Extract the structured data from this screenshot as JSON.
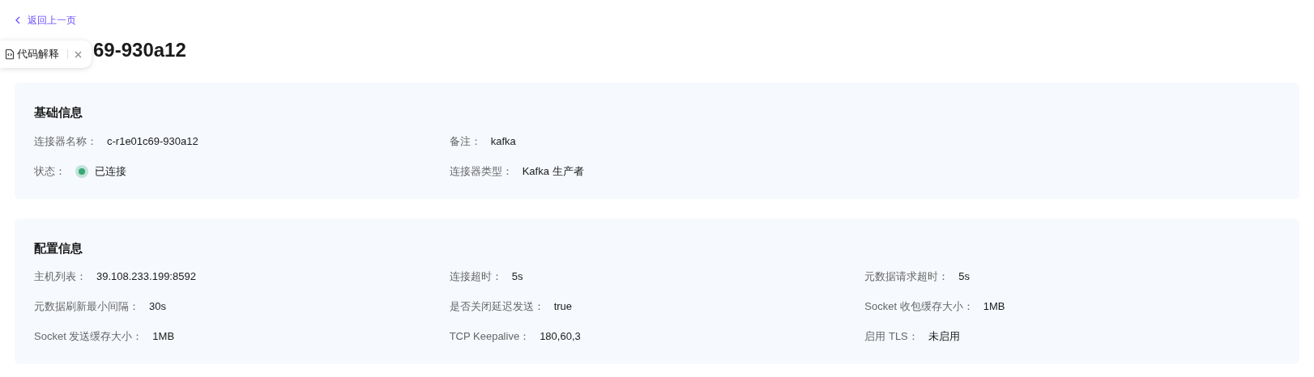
{
  "back_link": {
    "label": "返回上一页"
  },
  "title": "69-930a12",
  "popup": {
    "label": "代码解释"
  },
  "sections": [
    {
      "title": "基础信息",
      "rows": [
        [
          {
            "kind": "text",
            "label": "连接器名称：",
            "value": "c-r1e01c69-930a12"
          },
          {
            "kind": "text",
            "label": "备注：",
            "value": "kafka"
          }
        ],
        [
          {
            "kind": "status",
            "label": "状态：",
            "value": "已连接",
            "color": "#3aa876"
          },
          {
            "kind": "text",
            "label": "连接器类型：",
            "value": "Kafka 生产者"
          }
        ]
      ]
    },
    {
      "title": "配置信息",
      "rows": [
        [
          {
            "kind": "text",
            "label": "主机列表：",
            "value": "39.108.233.199:8592"
          },
          {
            "kind": "text",
            "label": "连接超时：",
            "value": "5s"
          },
          {
            "kind": "text",
            "label": "元数据请求超时：",
            "value": "5s"
          }
        ],
        [
          {
            "kind": "text",
            "label": "元数据刷新最小间隔：",
            "value": "30s"
          },
          {
            "kind": "text",
            "label": "是否关闭延迟发送：",
            "value": "true"
          },
          {
            "kind": "text",
            "label": "Socket 收包缓存大小：",
            "value": "1MB"
          }
        ],
        [
          {
            "kind": "text",
            "label": "Socket 发送缓存大小：",
            "value": "1MB"
          },
          {
            "kind": "text",
            "label": "TCP Keepalive：",
            "value": "180,60,3"
          },
          {
            "kind": "text",
            "label": "启用 TLS：",
            "value": "未启用"
          }
        ]
      ]
    }
  ]
}
